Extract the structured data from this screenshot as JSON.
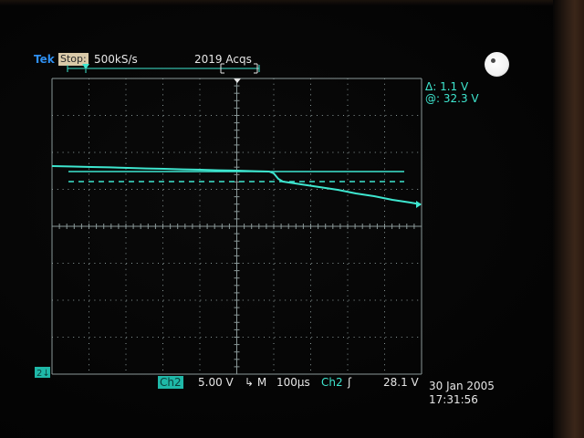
{
  "header": {
    "brand": "Tek",
    "acq_state": "Stop:",
    "sample_rate": "500kS/s",
    "acquisitions": "2019 Acqs"
  },
  "cursors": {
    "delta": "Δ: 1.1 V",
    "at": "@: 32.3 V"
  },
  "status_bar": {
    "channel_box": "Ch2",
    "volts_per_div": "5.00 V",
    "mode_symbol": "↳ M",
    "time_per_div": "100µs",
    "trigger_channel": "Ch2",
    "trigger_slope_symbol": "ʃ",
    "trigger_level": "28.1 V"
  },
  "channel_marker": "2↓",
  "date": "30 Jan 2005",
  "time": "17:31:56",
  "colors": {
    "trace": "#3ee6cf",
    "grid": "#8a9898",
    "brand": "#2f8ff0",
    "stop_badge": "#d9c9a8"
  }
}
